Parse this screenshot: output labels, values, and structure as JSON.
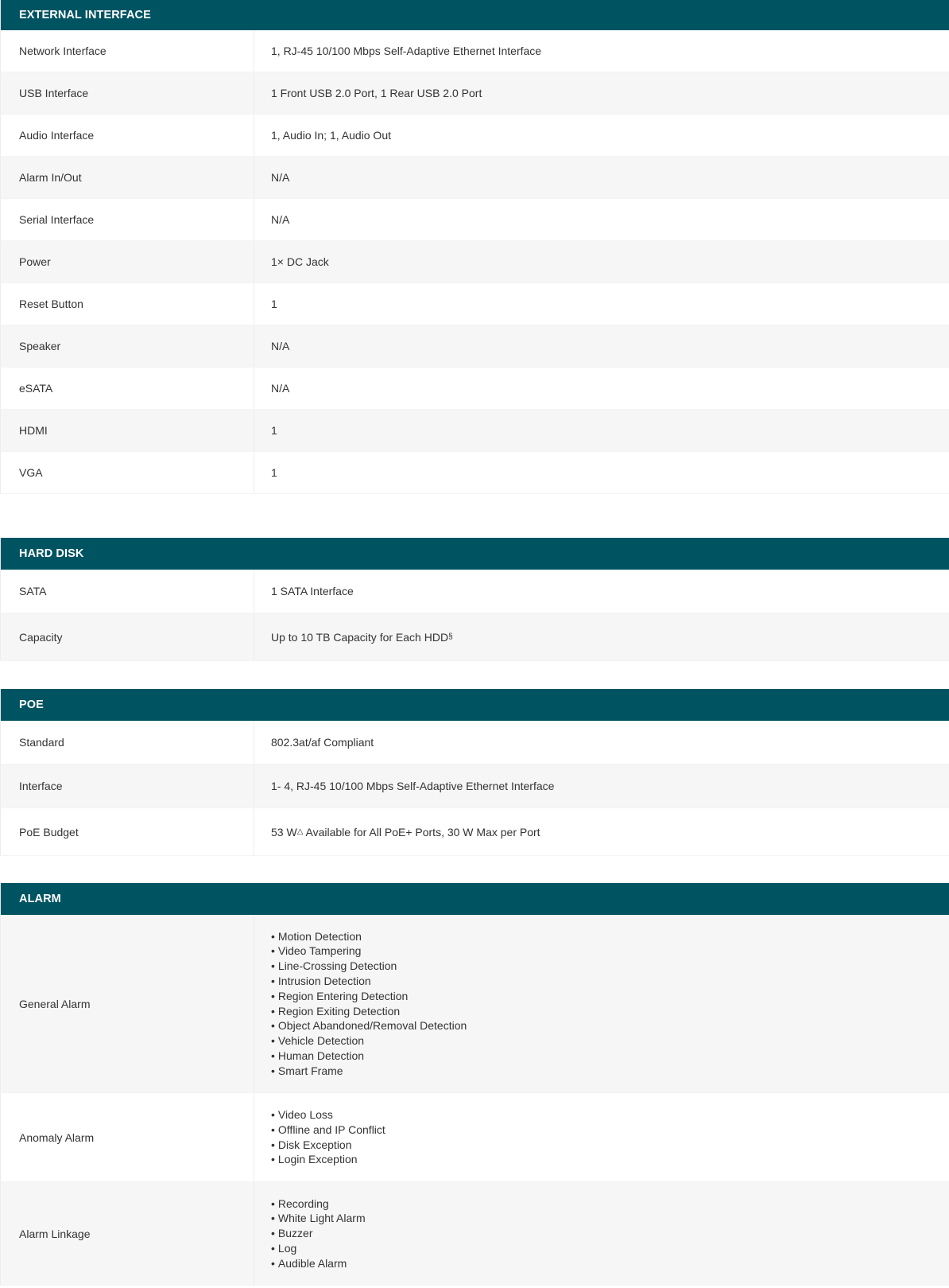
{
  "sections": {
    "external_interface": {
      "title": "EXTERNAL INTERFACE",
      "rows": [
        {
          "label": "Network Interface",
          "value": "1, RJ-45 10/100 Mbps Self-Adaptive Ethernet Interface"
        },
        {
          "label": "USB Interface",
          "value": "1 Front USB 2.0 Port, 1 Rear USB 2.0 Port"
        },
        {
          "label": "Audio Interface",
          "value": "1, Audio In; 1, Audio Out"
        },
        {
          "label": "Alarm In/Out",
          "value": "N/A"
        },
        {
          "label": "Serial Interface",
          "value": "N/A"
        },
        {
          "label": "Power",
          "value": "1× DC Jack"
        },
        {
          "label": "Reset Button",
          "value": "1"
        },
        {
          "label": "Speaker",
          "value": "N/A"
        },
        {
          "label": "eSATA",
          "value": "N/A"
        },
        {
          "label": "HDMI",
          "value": "1"
        },
        {
          "label": "VGA",
          "value": "1"
        }
      ]
    },
    "hard_disk": {
      "title": "HARD DISK",
      "rows": [
        {
          "label": "SATA",
          "value": "1 SATA Interface"
        },
        {
          "label": "Capacity",
          "value": "Up to 10 TB Capacity for Each HDD",
          "sup": "§"
        }
      ]
    },
    "poe": {
      "title": "POE",
      "rows": [
        {
          "label": "Standard",
          "value": "802.3at/af Compliant"
        },
        {
          "label": "Interface",
          "value": "1- 4, RJ-45 10/100 Mbps Self-Adaptive Ethernet Interface"
        },
        {
          "label": "PoE Budget",
          "value_before": "53 W",
          "sup": "△",
          "value_after": " Available for All PoE+ Ports, 30 W Max per Port"
        }
      ]
    },
    "alarm": {
      "title": "ALARM",
      "rows": [
        {
          "label": "General Alarm",
          "items": [
            "Motion Detection",
            "Video Tampering",
            "Line-Crossing Detection",
            "Intrusion Detection",
            "Region Entering Detection",
            "Region Exiting Detection",
            "Object Abandoned/Removal Detection",
            "Vehicle Detection",
            "Human Detection",
            "Smart Frame"
          ]
        },
        {
          "label": "Anomaly Alarm",
          "items": [
            "Video Loss",
            "Offline and IP Conflict",
            "Disk Exception",
            "Login Exception"
          ]
        },
        {
          "label": "Alarm Linkage",
          "items": [
            "Recording",
            "White Light Alarm",
            "Buzzer",
            "Log",
            "Audible Alarm"
          ]
        }
      ]
    }
  }
}
